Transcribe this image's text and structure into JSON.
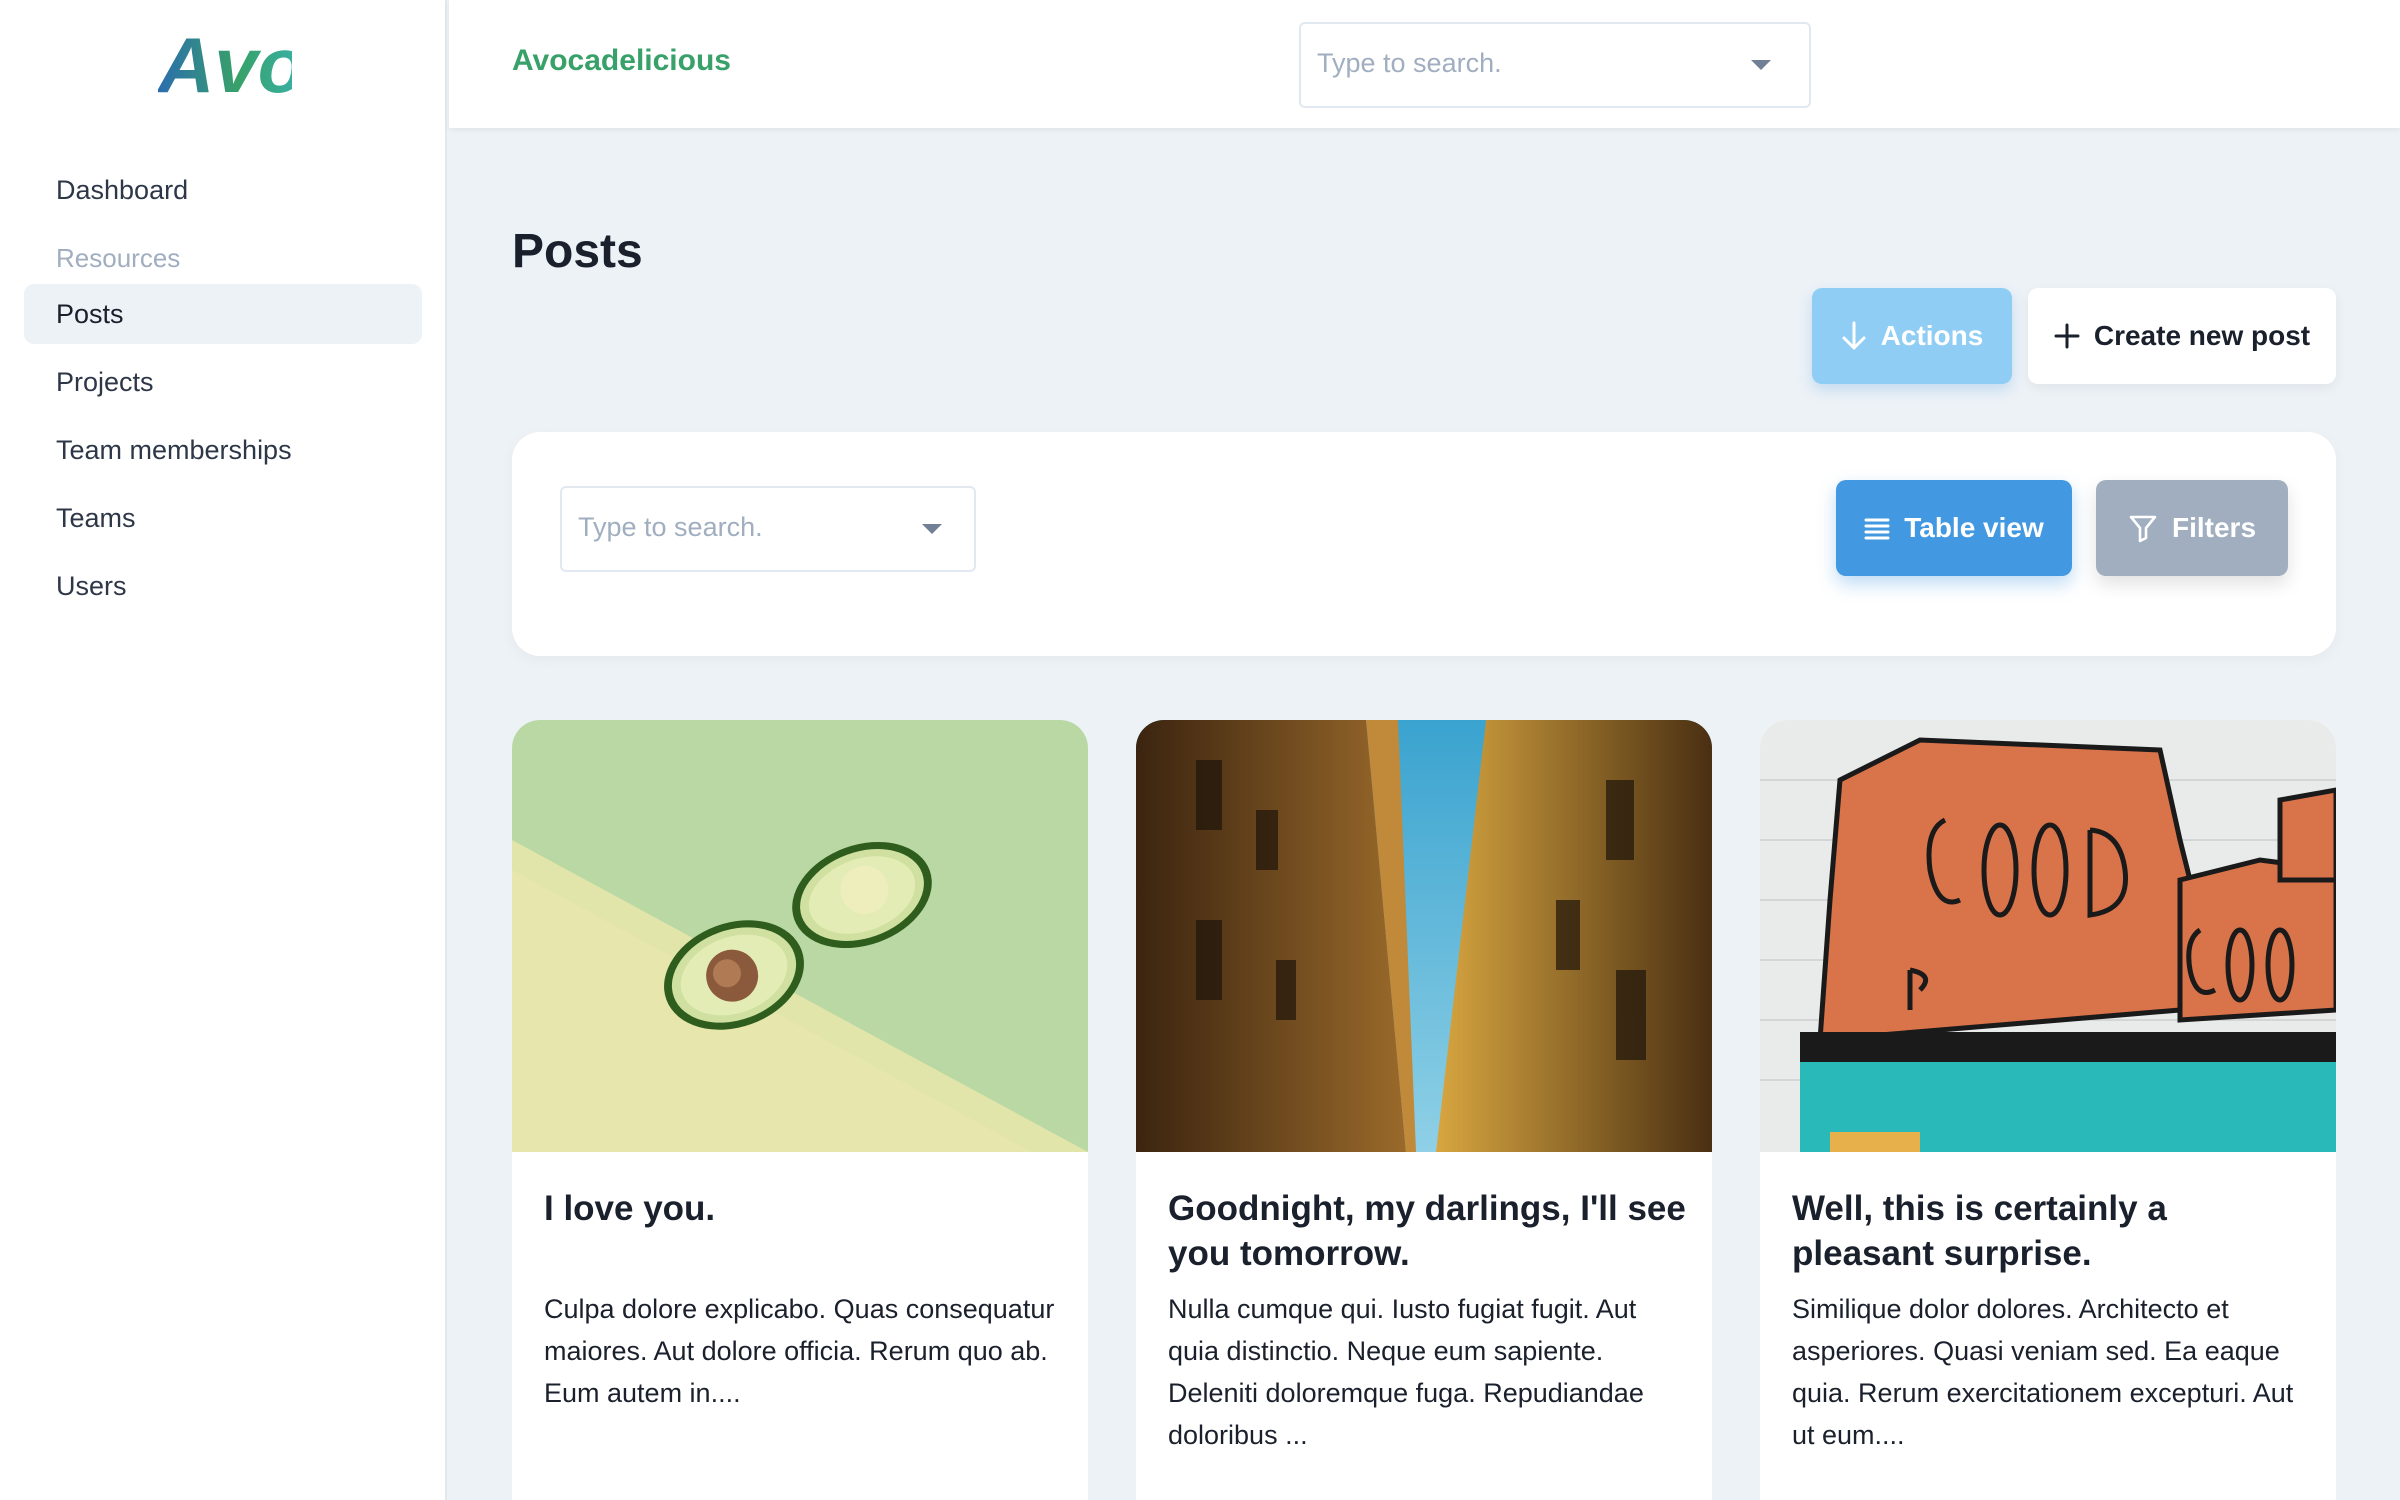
{
  "logo": {
    "text": "Avo"
  },
  "sidebar": {
    "dashboard": "Dashboard",
    "section_label": "Resources",
    "items": [
      {
        "label": "Posts",
        "active": true
      },
      {
        "label": "Projects"
      },
      {
        "label": "Team memberships"
      },
      {
        "label": "Teams"
      },
      {
        "label": "Users"
      }
    ]
  },
  "header": {
    "app_name": "Avocadelicious",
    "search_placeholder": "Type to search."
  },
  "main": {
    "title": "Posts",
    "actions_label": "Actions",
    "create_label": "Create new post",
    "filter_search_placeholder": "Type to search.",
    "table_view_label": "Table view",
    "filters_label": "Filters"
  },
  "posts": [
    {
      "title": "I love you.",
      "excerpt": "Culpa dolore explicabo. Quas consequatur maiores. Aut dolore officia. Rerum quo ab. Eum autem in...."
    },
    {
      "title": "Goodnight, my darlings, I'll see you tomorrow.",
      "excerpt": "Nulla cumque qui. Iusto fugiat fugit. Aut quia distinctio. Neque eum sapiente. Deleniti doloremque fuga. Repudiandae doloribus ..."
    },
    {
      "title": "Well, this is certainly a pleasant surprise.",
      "excerpt": "Similique dolor dolores. Architecto et asperiores. Quasi veniam sed. Ea eaque quia. Rerum exercitationem excepturi. Aut ut eum...."
    }
  ],
  "colors": {
    "brand_green": "#38a169",
    "primary_blue": "#4299e1",
    "light_blue": "#90cdf4",
    "gray": "#a0aec0"
  }
}
